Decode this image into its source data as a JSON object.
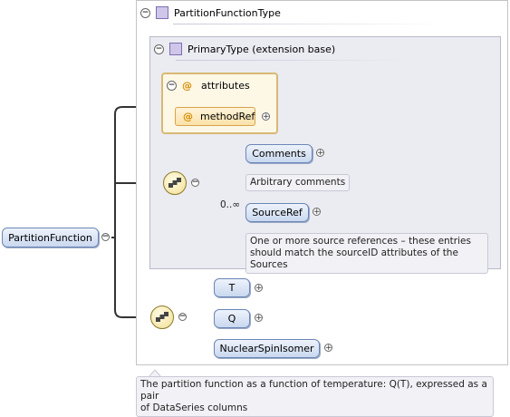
{
  "root_element": {
    "name": "PartitionFunction"
  },
  "complex_type": {
    "name": "PartitionFunctionType"
  },
  "base_type": {
    "name": "PrimaryType (extension base)"
  },
  "attributes_group": {
    "label": "attributes",
    "items": [
      {
        "name": "methodRef"
      }
    ]
  },
  "primary_sequence": {
    "comments": {
      "name": "Comments",
      "doc": "Arbitrary comments"
    },
    "source_ref": {
      "name": "SourceRef",
      "occurrence": "0..∞",
      "doc_line1": "One or more source references – these entries",
      "doc_line2": "should match the sourceID attributes of the Sources"
    }
  },
  "partition_sequence": {
    "items": [
      {
        "name": "T"
      },
      {
        "name": "Q"
      },
      {
        "name": "NuclearSpinIsomer"
      }
    ]
  },
  "root_doc": {
    "line1": "The partition function as a function of temperature: Q(T), expressed as a pair",
    "line2": "of DataSeries columns"
  },
  "colors": {
    "element_border": "#6b86b6",
    "attribute_border": "#d9b873",
    "sequence_fill": "#f1df93",
    "type_square": "#cfc6ea"
  }
}
